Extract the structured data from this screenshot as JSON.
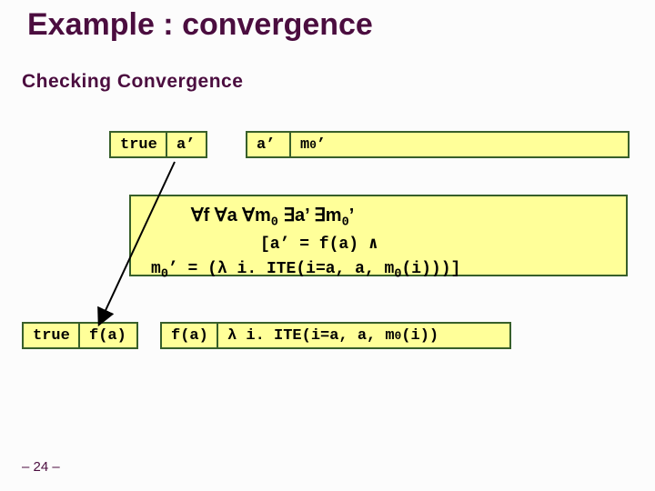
{
  "title": "Example : convergence",
  "subtitle": "Checking Convergence",
  "box_tl": {
    "c1": "true",
    "c2": "a’"
  },
  "box_tr": {
    "c1": "a’",
    "c2_pre": "m",
    "c2_sub": "0",
    "c2_post": "’"
  },
  "formula": {
    "l1_pre": "∀f ∀a ∀m",
    "l1_sub1": "0",
    "l1_mid1": " ∃a’ ∃m",
    "l1_sub2": "0",
    "l1_post": "’",
    "l2": "[a’ = f(a) ∧",
    "l3_pre": "m",
    "l3_sub1": "0",
    "l3_mid": "’ = (λ i. ITE(i=a, a, m",
    "l3_sub2": "0",
    "l3_post": "(i)))]"
  },
  "box_bl": {
    "c1": "true",
    "c2": "f(a)"
  },
  "box_br": {
    "c1": "f(a)",
    "c2_pre": "λ i. ITE(i=a, a, m",
    "c2_sub": "0",
    "c2_post": "(i))"
  },
  "pagenum": "– 24 –"
}
